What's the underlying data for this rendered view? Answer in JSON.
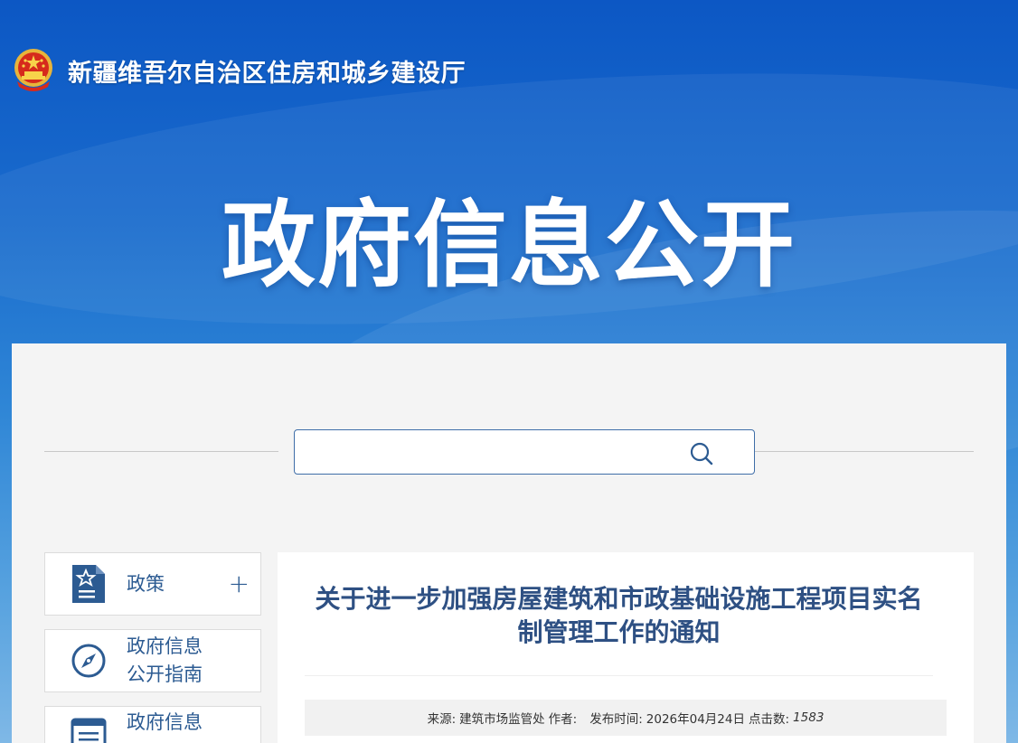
{
  "header": {
    "site_name": "新疆维吾尔自治区住房和城乡建设厅",
    "emblem_icon": "national-emblem-icon"
  },
  "banner": {
    "title": "政府信息公开"
  },
  "search": {
    "value": "",
    "placeholder": "",
    "icon": "search-icon"
  },
  "sidebar": {
    "items": [
      {
        "label_line1": "政策",
        "label_line2": "",
        "icon": "policy-document-icon",
        "expand": "+"
      },
      {
        "label_line1": "政府信息",
        "label_line2": "公开指南",
        "icon": "compass-icon"
      },
      {
        "label_line1": "政府信息",
        "label_line2": "",
        "icon": "list-document-icon"
      }
    ]
  },
  "article": {
    "title": "关于进一步加强房屋建筑和市政基础设施工程项目实名制管理工作的通知",
    "meta": {
      "source_label": "来源:",
      "source": "建筑市场监管处",
      "author_label": "作者:",
      "author": "",
      "publish_label": "发布时间:",
      "publish_date": "2026年04月24日",
      "clicks_label": "点击数:",
      "clicks": "1583"
    }
  },
  "colors": {
    "banner_top": "#0c57c4",
    "accent_blue": "#2c5b92",
    "title_blue": "#2e5083",
    "panel_bg": "#f4f4f4"
  }
}
